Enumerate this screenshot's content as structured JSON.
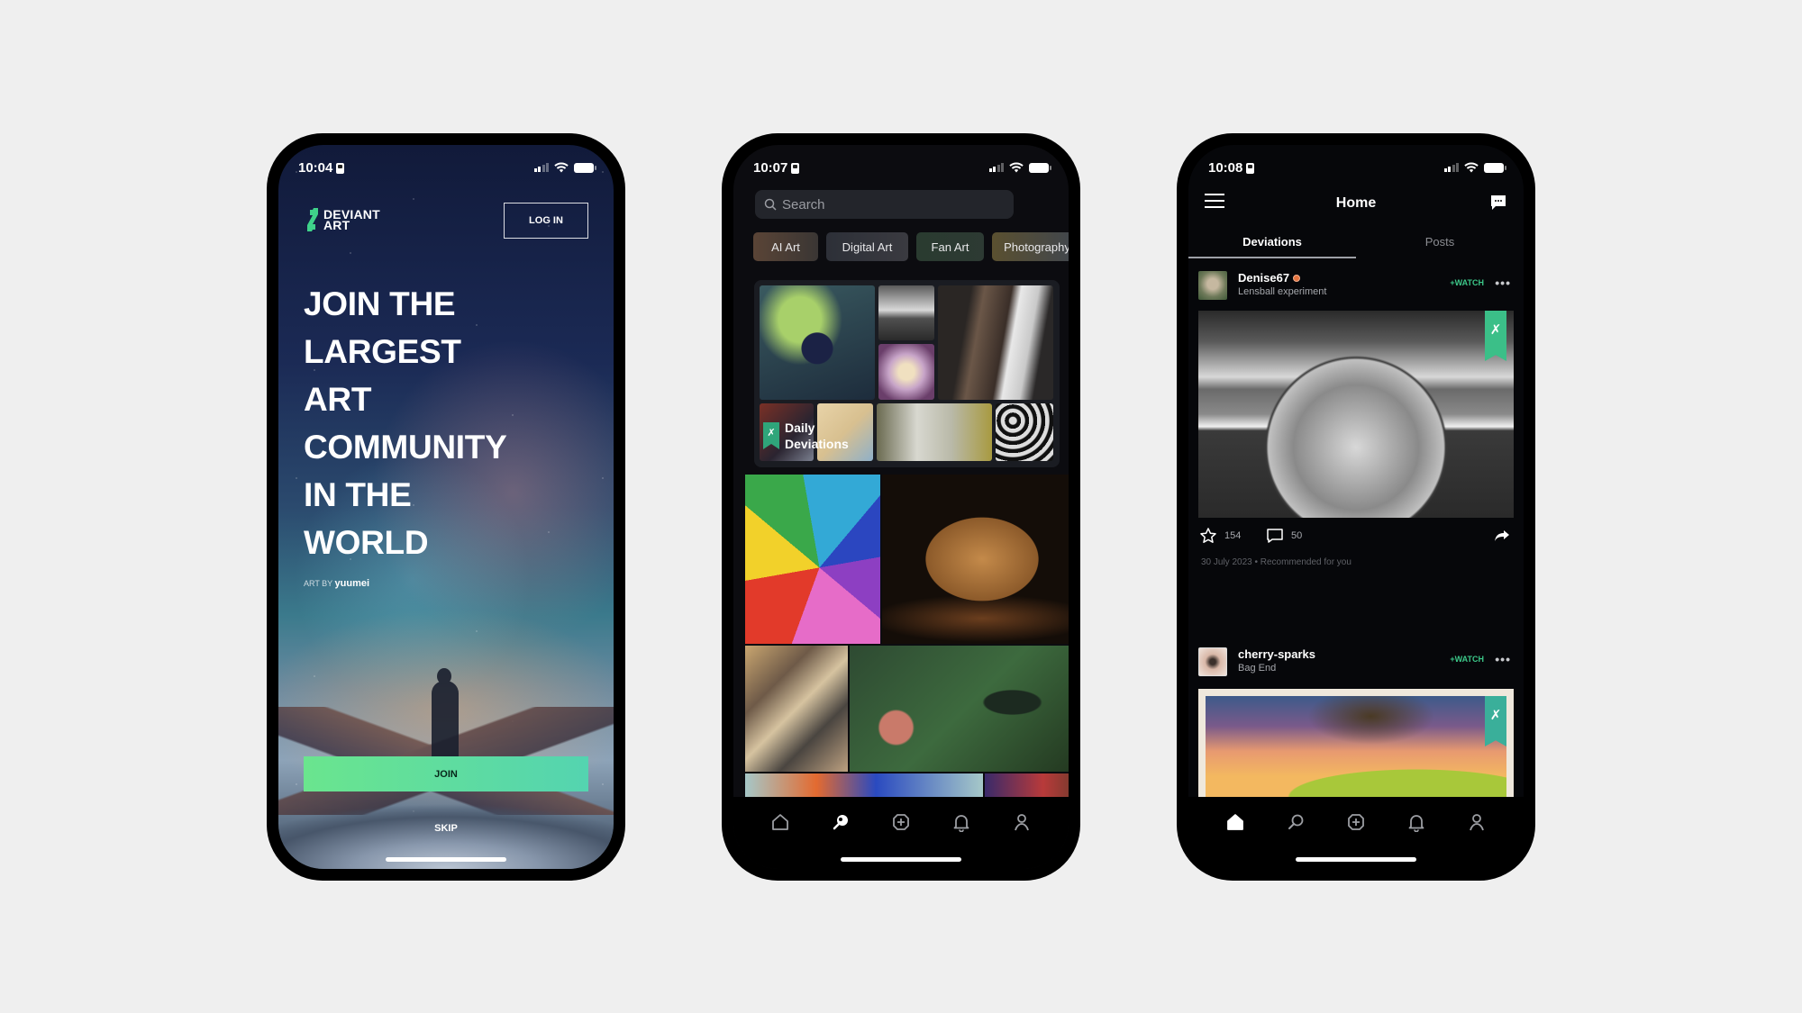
{
  "colors": {
    "accent_green": "#3cc98a",
    "join_gradient_start": "#6ae58e",
    "join_gradient_end": "#54d4b0",
    "background": "#efefef"
  },
  "phones": {
    "welcome": {
      "status_time": "10:04",
      "logo": {
        "line1": "DEVIANT",
        "line2": "ART",
        "icon": "deviantart-logo-icon"
      },
      "login_label": "LOG IN",
      "headline": [
        "JOIN THE",
        "LARGEST",
        "ART",
        "COMMUNITY",
        "IN THE",
        "WORLD"
      ],
      "credit_prefix": "ART BY",
      "credit_artist": "yuumei",
      "join_label": "JOIN",
      "skip_label": "SKIP"
    },
    "discover": {
      "status_time": "10:07",
      "search_placeholder": "Search",
      "chips": [
        "AI Art",
        "Digital Art",
        "Fan Art",
        "Photography"
      ],
      "daily_deviations": {
        "line1": "Daily",
        "line2": "Deviations"
      },
      "nav": [
        "home-icon",
        "search-icon",
        "create-icon",
        "notifications-icon",
        "profile-icon"
      ],
      "active_nav": "search-icon"
    },
    "home": {
      "status_time": "10:08",
      "title": "Home",
      "tabs": [
        {
          "label": "Deviations",
          "active": true
        },
        {
          "label": "Posts",
          "active": false
        }
      ],
      "posts": [
        {
          "username": "Denise67",
          "title": "Lensball experiment",
          "watch_label": "+WATCH",
          "favorites": "154",
          "comments": "50",
          "meta": "30 July 2023 • Recommended for you"
        },
        {
          "username": "cherry-sparks",
          "title": "Bag End",
          "watch_label": "+WATCH"
        }
      ],
      "nav": [
        "home-icon",
        "search-icon",
        "create-icon",
        "notifications-icon",
        "profile-icon"
      ],
      "active_nav": "home-icon"
    }
  }
}
